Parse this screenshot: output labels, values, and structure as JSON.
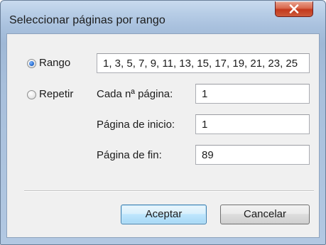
{
  "dialog": {
    "title": "Seleccionar páginas por rango"
  },
  "options": {
    "rango": {
      "label": "Rango",
      "selected": true,
      "value": "1, 3, 5, 7, 9, 11, 13, 15, 17, 19, 21, 23, 25"
    },
    "repetir": {
      "label": "Repetir",
      "selected": false
    }
  },
  "repeat_fields": {
    "cada": {
      "label": "Cada nª página:",
      "value": "1"
    },
    "inicio": {
      "label": "Página de inicio:",
      "value": "1"
    },
    "fin": {
      "label": "Página de fin:",
      "value": "89"
    }
  },
  "buttons": {
    "accept": "Aceptar",
    "cancel": "Cancelar"
  },
  "icons": {
    "close": "close-icon"
  },
  "colors": {
    "close_button": "#c3391d",
    "default_button_border": "#3c7fb1",
    "dialog_background": "#f0f0f0"
  }
}
